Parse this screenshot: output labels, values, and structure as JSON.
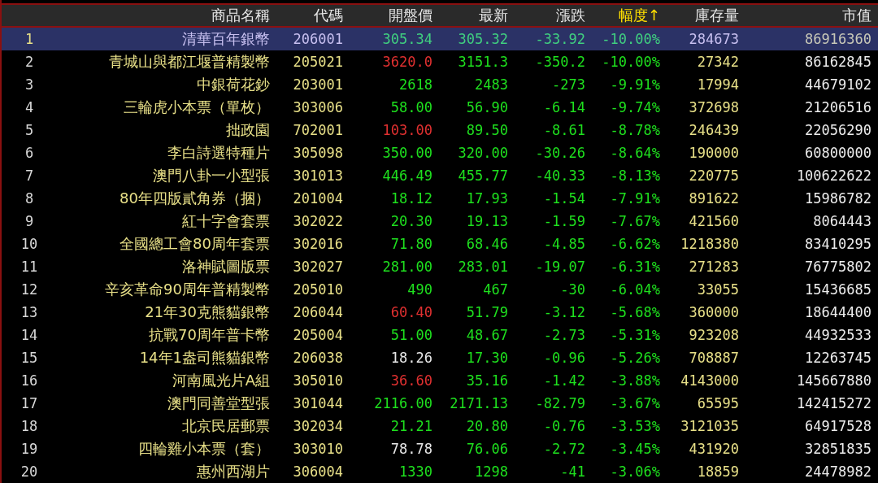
{
  "table": {
    "columns": [
      {
        "label": "商品名稱",
        "sorted": false
      },
      {
        "label": "代碼",
        "sorted": false
      },
      {
        "label": "開盤價",
        "sorted": false
      },
      {
        "label": "最新",
        "sorted": false
      },
      {
        "label": "漲跌",
        "sorted": false
      },
      {
        "label": "幅度",
        "sorted": true,
        "sort_mark": "↑"
      },
      {
        "label": "庫存量",
        "sorted": false
      },
      {
        "label": "市值",
        "sorted": false
      }
    ],
    "rows": [
      {
        "index": "1",
        "name": "清華百年銀幣",
        "code": "206001",
        "open": {
          "text": "305.34",
          "color": "#40d080"
        },
        "latest": "305.32",
        "change": "-33.92",
        "pct": "-10.00%",
        "stock": "284673",
        "cap": "86916360",
        "selected": true
      },
      {
        "index": "2",
        "name": "青城山與都江堰普精製幣",
        "code": "205021",
        "open": {
          "text": "3620.0",
          "color": "#e03030"
        },
        "latest": "3151.3",
        "change": "-350.2",
        "pct": "-10.00%",
        "stock": "27342",
        "cap": "86162845",
        "selected": false
      },
      {
        "index": "3",
        "name": "中銀荷花鈔",
        "code": "203001",
        "open": {
          "text": "2618",
          "color": "#1ee01e"
        },
        "latest": "2483",
        "change": "-273",
        "pct": "-9.91%",
        "stock": "17994",
        "cap": "44679102",
        "selected": false
      },
      {
        "index": "4",
        "name": "三輪虎小本票（單枚）",
        "code": "303006",
        "open": {
          "text": "58.00",
          "color": "#1ee01e"
        },
        "latest": "56.90",
        "change": "-6.14",
        "pct": "-9.74%",
        "stock": "372698",
        "cap": "21206516",
        "selected": false
      },
      {
        "index": "5",
        "name": "拙政園",
        "code": "702001",
        "open": {
          "text": "103.00",
          "color": "#e03030"
        },
        "latest": "89.50",
        "change": "-8.61",
        "pct": "-8.78%",
        "stock": "246439",
        "cap": "22056290",
        "selected": false
      },
      {
        "index": "6",
        "name": "李白詩選特種片",
        "code": "305098",
        "open": {
          "text": "350.00",
          "color": "#1ee01e"
        },
        "latest": "320.00",
        "change": "-30.26",
        "pct": "-8.64%",
        "stock": "190000",
        "cap": "60800000",
        "selected": false
      },
      {
        "index": "7",
        "name": "澳門八卦一小型張",
        "code": "301013",
        "open": {
          "text": "446.49",
          "color": "#1ee01e"
        },
        "latest": "455.77",
        "change": "-40.33",
        "pct": "-8.13%",
        "stock": "220775",
        "cap": "100622622",
        "selected": false
      },
      {
        "index": "8",
        "name": "80年四版貳角券（捆）",
        "code": "201004",
        "open": {
          "text": "18.12",
          "color": "#1ee01e"
        },
        "latest": "17.93",
        "change": "-1.54",
        "pct": "-7.91%",
        "stock": "891622",
        "cap": "15986782",
        "selected": false
      },
      {
        "index": "9",
        "name": "紅十字會套票",
        "code": "302022",
        "open": {
          "text": "20.30",
          "color": "#1ee01e"
        },
        "latest": "19.13",
        "change": "-1.59",
        "pct": "-7.67%",
        "stock": "421560",
        "cap": "8064443",
        "selected": false
      },
      {
        "index": "10",
        "name": "全國總工會80周年套票",
        "code": "302016",
        "open": {
          "text": "71.80",
          "color": "#1ee01e"
        },
        "latest": "68.46",
        "change": "-4.85",
        "pct": "-6.62%",
        "stock": "1218380",
        "cap": "83410295",
        "selected": false
      },
      {
        "index": "11",
        "name": "洛神賦圖版票",
        "code": "302027",
        "open": {
          "text": "281.00",
          "color": "#1ee01e"
        },
        "latest": "283.01",
        "change": "-19.07",
        "pct": "-6.31%",
        "stock": "271283",
        "cap": "76775802",
        "selected": false
      },
      {
        "index": "12",
        "name": "辛亥革命90周年普精製幣",
        "code": "205010",
        "open": {
          "text": "490",
          "color": "#1ee01e"
        },
        "latest": "467",
        "change": "-30",
        "pct": "-6.04%",
        "stock": "33055",
        "cap": "15436685",
        "selected": false
      },
      {
        "index": "13",
        "name": "21年30克熊貓銀幣",
        "code": "206044",
        "open": {
          "text": "60.40",
          "color": "#e03030"
        },
        "latest": "51.79",
        "change": "-3.12",
        "pct": "-5.68%",
        "stock": "360000",
        "cap": "18644400",
        "selected": false
      },
      {
        "index": "14",
        "name": "抗戰70周年普卡幣",
        "code": "205004",
        "open": {
          "text": "51.00",
          "color": "#1ee01e"
        },
        "latest": "48.67",
        "change": "-2.73",
        "pct": "-5.31%",
        "stock": "923208",
        "cap": "44932533",
        "selected": false
      },
      {
        "index": "15",
        "name": "14年1盎司熊貓銀幣",
        "code": "206038",
        "open": {
          "text": "18.26",
          "color": "#e8e8e8"
        },
        "latest": "17.30",
        "change": "-0.96",
        "pct": "-5.26%",
        "stock": "708887",
        "cap": "12263745",
        "selected": false
      },
      {
        "index": "16",
        "name": "河南風光片A組",
        "code": "305010",
        "open": {
          "text": "36.60",
          "color": "#e03030"
        },
        "latest": "35.16",
        "change": "-1.42",
        "pct": "-3.88%",
        "stock": "4143000",
        "cap": "145667880",
        "selected": false
      },
      {
        "index": "17",
        "name": "澳門同善堂型張",
        "code": "301044",
        "open": {
          "text": "2116.00",
          "color": "#1ee01e"
        },
        "latest": "2171.13",
        "change": "-82.79",
        "pct": "-3.67%",
        "stock": "65595",
        "cap": "142415272",
        "selected": false
      },
      {
        "index": "18",
        "name": "北京民居郵票",
        "code": "302034",
        "open": {
          "text": "21.21",
          "color": "#1ee01e"
        },
        "latest": "20.80",
        "change": "-0.76",
        "pct": "-3.53%",
        "stock": "3121035",
        "cap": "64917528",
        "selected": false
      },
      {
        "index": "19",
        "name": "四輪雞小本票（套）",
        "code": "303010",
        "open": {
          "text": "78.78",
          "color": "#e8e8e8"
        },
        "latest": "76.06",
        "change": "-2.72",
        "pct": "-3.45%",
        "stock": "431920",
        "cap": "32851835",
        "selected": false
      },
      {
        "index": "20",
        "name": "惠州西湖片",
        "code": "306004",
        "open": {
          "text": "1330",
          "color": "#1ee01e"
        },
        "latest": "1298",
        "change": "-41",
        "pct": "-3.06%",
        "stock": "18859",
        "cap": "24478982",
        "selected": false
      }
    ]
  }
}
